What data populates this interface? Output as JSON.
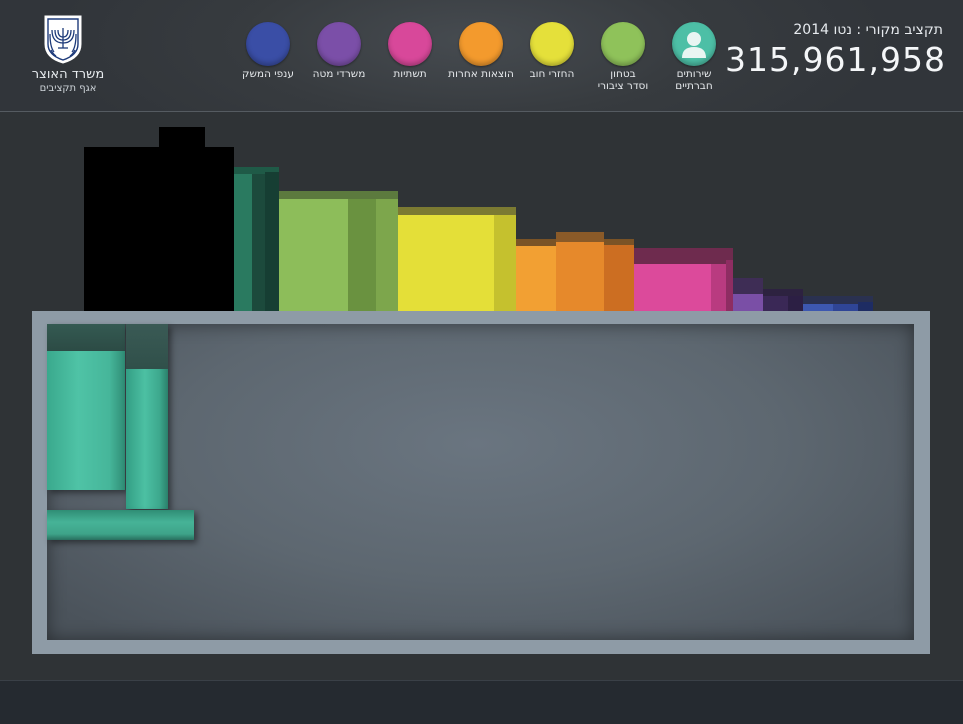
{
  "header": {
    "ministry_title": "משרד האוצר",
    "ministry_subtitle": "אגף תקציבים",
    "budget_caption": "תקציב מקורי : נטו 2014",
    "budget_total": "315,961,958"
  },
  "categories": [
    {
      "label": "ענפי המשק",
      "color": "#3a4ea6",
      "icon": "dot"
    },
    {
      "label": "משרדי מטה",
      "color": "#7b4fa8",
      "icon": "dot"
    },
    {
      "label": "תשתיות",
      "color": "#d8489a",
      "icon": "dot"
    },
    {
      "label": "הוצאות אחרות",
      "color": "#f39a2d",
      "icon": "dot"
    },
    {
      "label": "החזרי חוב",
      "color": "#e5e03a",
      "icon": "dot"
    },
    {
      "label": "בטחון\nוסדר ציבורי",
      "color": "#8fc25a",
      "icon": "dot"
    },
    {
      "label": "שירותים\nחברתיים",
      "color": "#4dbfa6",
      "icon": "person-icon"
    }
  ],
  "colors": {
    "header_bg": "#373b3f",
    "panel_frame": "#8e9ba6",
    "panel_bg": "#5f6972"
  }
}
